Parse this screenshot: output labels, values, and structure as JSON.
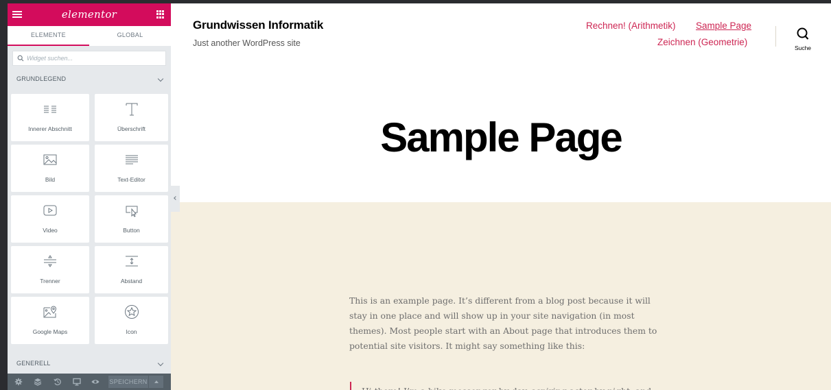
{
  "sidebar": {
    "logo": "elementor",
    "tabs": [
      {
        "label": "ELEMENTE",
        "active": true
      },
      {
        "label": "GLOBAL",
        "active": false
      }
    ],
    "search": {
      "placeholder": "Widget suchen...",
      "value": ""
    },
    "section_basic": "GRUNDLEGEND",
    "widgets": [
      {
        "label": "Innerer Abschnitt",
        "icon": "inner-section-icon"
      },
      {
        "label": "Überschrift",
        "icon": "heading-icon"
      },
      {
        "label": "Bild",
        "icon": "image-icon"
      },
      {
        "label": "Text-Editor",
        "icon": "text-editor-icon"
      },
      {
        "label": "Video",
        "icon": "video-icon"
      },
      {
        "label": "Button",
        "icon": "button-icon"
      },
      {
        "label": "Trenner",
        "icon": "divider-icon"
      },
      {
        "label": "Abstand",
        "icon": "spacer-icon"
      },
      {
        "label": "Google Maps",
        "icon": "google-maps-icon"
      },
      {
        "label": "Icon",
        "icon": "star-icon"
      }
    ],
    "section_general": "GENERELL",
    "footer": {
      "save_label": "SPEICHERN",
      "icons": [
        "settings-icon",
        "navigator-icon",
        "history-icon",
        "responsive-icon",
        "preview-icon"
      ]
    }
  },
  "site": {
    "title": "Grundwissen Informatik",
    "description": "Just another WordPress site",
    "nav": [
      {
        "label": "Rechnen! (Arithmetik)",
        "current": false
      },
      {
        "label": "Sample Page",
        "current": true
      },
      {
        "label": "Zeichnen (Geometrie)",
        "current": false
      }
    ],
    "search_label": "Suche"
  },
  "page": {
    "title": "Sample Page",
    "paragraph": "This is an example page. It’s different from a blog post because it will stay in one place and will show up in your site navigation (in most themes). Most people start with an About page that introduces them to potential site visitors. It might say something like this:",
    "quote": "Hi there! I’m a bike messenger by day, aspiring actor by night, and"
  },
  "colors": {
    "elementor_pink": "#d30c5c",
    "link_accent": "#cd2653",
    "panel_bg": "#e6e9ec",
    "content_bg": "#f5efe0",
    "footer_bg": "#556068"
  }
}
